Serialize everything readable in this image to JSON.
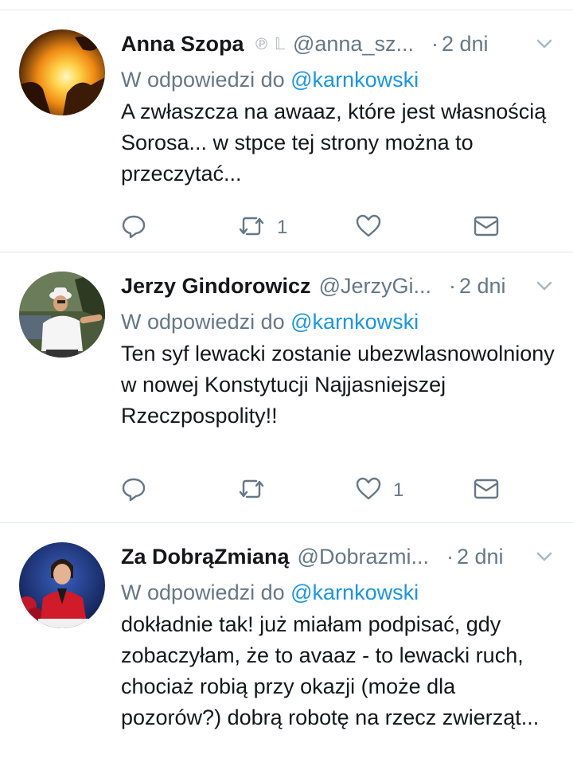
{
  "tweets": [
    {
      "name": "Anna Szopa",
      "badges": "℗ 𝕃",
      "handle": "@anna_sz...",
      "dot": "·",
      "time": "2 dni",
      "reply_prefix": "W odpowiedzi do",
      "reply_to": "@karnkowski",
      "text": "A zwłaszcza na awaaz, które jest własnością Sorosa... w stpce tej strony można to przeczytać...",
      "retweets": "1",
      "likes": ""
    },
    {
      "name": "Jerzy Gindorowicz",
      "handle": "@JerzyGi...",
      "dot": "·",
      "time": "2 dni",
      "reply_prefix": "W odpowiedzi do",
      "reply_to": "@karnkowski",
      "text": "Ten syf lewacki zostanie ubezwlasnowolniony w nowej Konstytucji Najjasniejszej Rzeczpospolity!!",
      "retweets": "",
      "likes": "1"
    },
    {
      "name": "Za DobrąZmianą",
      "handle": "@Dobrazmi...",
      "dot": "·",
      "time": "2 dni",
      "reply_prefix": "W odpowiedzi do",
      "reply_to": "@karnkowski",
      "text": "dokładnie tak! już miałam podpisać, gdy zobaczyłam, że to avaaz - to lewacki ruch, chociaż robią przy okazji (może dla pozorów?) dobrą robotę na rzecz zwierząt...",
      "retweets": "",
      "likes": ""
    }
  ],
  "colors": {
    "link": "#1b95e0",
    "secondary": "#657786",
    "divider": "#e1e8ed"
  },
  "icons": [
    "reply-icon",
    "retweet-icon",
    "like-icon",
    "direct-message-icon",
    "chevron-down-icon"
  ]
}
